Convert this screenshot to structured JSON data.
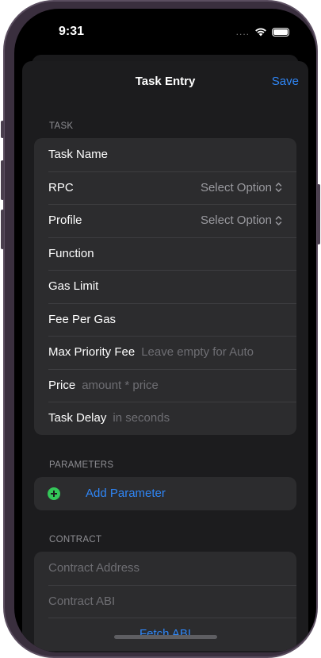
{
  "status_bar": {
    "time": "9:31",
    "signal": "....",
    "wifi_icon": "wifi-icon",
    "battery_icon": "battery-icon"
  },
  "nav": {
    "title": "Task Entry",
    "save_label": "Save"
  },
  "task_section": {
    "header": "TASK",
    "rows": [
      {
        "label": "Task Name",
        "placeholder": "",
        "picker": ""
      },
      {
        "label": "RPC",
        "placeholder": "",
        "picker": "Select Option"
      },
      {
        "label": "Profile",
        "placeholder": "",
        "picker": "Select Option"
      },
      {
        "label": "Function",
        "placeholder": "",
        "picker": ""
      },
      {
        "label": "Gas Limit",
        "placeholder": "",
        "picker": ""
      },
      {
        "label": "Fee Per Gas",
        "placeholder": "",
        "picker": ""
      },
      {
        "label": "Max Priority Fee",
        "placeholder": "Leave empty for Auto",
        "picker": ""
      },
      {
        "label": "Price",
        "placeholder": "amount * price",
        "picker": ""
      },
      {
        "label": "Task Delay",
        "placeholder": "in seconds",
        "picker": ""
      }
    ]
  },
  "parameters_section": {
    "header": "PARAMETERS",
    "add_label": "Add Parameter"
  },
  "contract_section": {
    "header": "CONTRACT",
    "address_placeholder": "Contract Address",
    "abi_placeholder": "Contract ABI",
    "fetch_label": "Fetch ABI"
  },
  "colors": {
    "accent": "#2f86f6",
    "add_green": "#34c759",
    "background": "#1c1c1e",
    "cell": "#2c2c2e"
  }
}
